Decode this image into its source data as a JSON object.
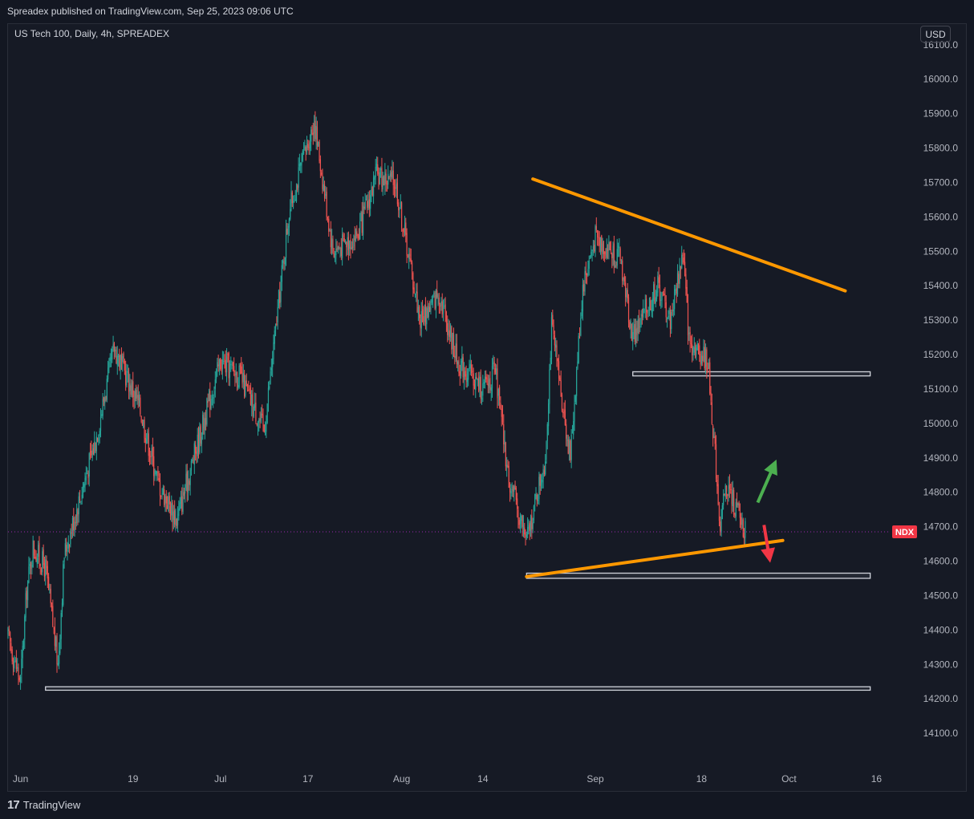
{
  "header": {
    "published": "Spreadex published on TradingView.com, Sep 25, 2023 09:06 UTC"
  },
  "legend": {
    "symbol_line": "US Tech 100, Daily, 4h, SPREADEX"
  },
  "price_scale": {
    "currency": "USD"
  },
  "footer": {
    "brand": "TradingView"
  },
  "colors": {
    "background": "#161a25",
    "up": "#26a69a",
    "down": "#ef5350",
    "trendline": "#ff9800",
    "arrow_up": "#4caf50",
    "arrow_down": "#f23645",
    "current_price_line": "#9c27b0",
    "ndx_label": "#f23645",
    "zone_border": "#d1d4dc"
  },
  "chart_data": {
    "type": "candlestick",
    "title": "US Tech 100, Daily, 4h, SPREADEX",
    "y_axis": {
      "ticks": [
        14100,
        14200,
        14300,
        14400,
        14500,
        14600,
        14700,
        14800,
        14900,
        15000,
        15100,
        15200,
        15300,
        15400,
        15500,
        15600,
        15700,
        15800,
        15900,
        16000,
        16100
      ],
      "ylim": [
        14000,
        16160
      ],
      "label_format": "one_decimal"
    },
    "x_axis": {
      "ticks": [
        {
          "label": "Jun",
          "date": "2023-06-01"
        },
        {
          "label": "19",
          "date": "2023-06-19"
        },
        {
          "label": "Jul",
          "date": "2023-07-03"
        },
        {
          "label": "17",
          "date": "2023-07-17"
        },
        {
          "label": "Aug",
          "date": "2023-08-01"
        },
        {
          "label": "14",
          "date": "2023-08-14"
        },
        {
          "label": "Sep",
          "date": "2023-09-01"
        },
        {
          "label": "18",
          "date": "2023-09-18"
        },
        {
          "label": "Oct",
          "date": "2023-10-02"
        },
        {
          "label": "16",
          "date": "2023-10-16"
        }
      ],
      "range": [
        "2023-05-30",
        "2023-10-18"
      ]
    },
    "current_price": {
      "label": "NDX",
      "value": 14685
    },
    "price_path": [
      [
        "2023-05-30",
        14380
      ],
      [
        "2023-06-01",
        14250
      ],
      [
        "2023-06-02",
        14520
      ],
      [
        "2023-06-03",
        14640
      ],
      [
        "2023-06-05",
        14580
      ],
      [
        "2023-06-07",
        14300
      ],
      [
        "2023-06-08",
        14620
      ],
      [
        "2023-06-13",
        14950
      ],
      [
        "2023-06-16",
        15220
      ],
      [
        "2023-06-20",
        15050
      ],
      [
        "2023-06-23",
        14830
      ],
      [
        "2023-06-26",
        14720
      ],
      [
        "2023-06-29",
        14920
      ],
      [
        "2023-07-03",
        15180
      ],
      [
        "2023-07-06",
        15140
      ],
      [
        "2023-07-10",
        14980
      ],
      [
        "2023-07-14",
        15620
      ],
      [
        "2023-07-18",
        15880
      ],
      [
        "2023-07-21",
        15500
      ],
      [
        "2023-07-25",
        15550
      ],
      [
        "2023-07-28",
        15720
      ],
      [
        "2023-07-31",
        15700
      ],
      [
        "2023-08-04",
        15300
      ],
      [
        "2023-08-07",
        15380
      ],
      [
        "2023-08-10",
        15180
      ],
      [
        "2023-08-14",
        15100
      ],
      [
        "2023-08-16",
        15150
      ],
      [
        "2023-08-18",
        14850
      ],
      [
        "2023-08-21",
        14660
      ],
      [
        "2023-08-24",
        14900
      ],
      [
        "2023-08-25",
        15280
      ],
      [
        "2023-08-28",
        14900
      ],
      [
        "2023-08-30",
        15400
      ],
      [
        "2023-09-01",
        15540
      ],
      [
        "2023-09-05",
        15480
      ],
      [
        "2023-09-07",
        15250
      ],
      [
        "2023-09-11",
        15400
      ],
      [
        "2023-09-13",
        15300
      ],
      [
        "2023-09-15",
        15500
      ],
      [
        "2023-09-16",
        15240
      ],
      [
        "2023-09-19",
        15180
      ],
      [
        "2023-09-20",
        14950
      ],
      [
        "2023-09-21",
        14700
      ],
      [
        "2023-09-22",
        14820
      ],
      [
        "2023-09-25",
        14685
      ]
    ],
    "annotations": {
      "trendlines": [
        {
          "name": "resistance",
          "start": [
            "2023-08-22",
            15710
          ],
          "end": [
            "2023-10-11",
            15385
          ]
        },
        {
          "name": "support",
          "start": [
            "2023-08-21",
            14555
          ],
          "end": [
            "2023-10-01",
            14660
          ]
        }
      ],
      "zones": [
        {
          "name": "zone-15150",
          "start": "2023-09-07",
          "end": "2023-10-15",
          "low": 15138,
          "high": 15150
        },
        {
          "name": "zone-14560",
          "start": "2023-08-21",
          "end": "2023-10-15",
          "low": 14550,
          "high": 14565
        },
        {
          "name": "zone-14230",
          "start": "2023-06-05",
          "end": "2023-10-15",
          "low": 14225,
          "high": 14235
        }
      ],
      "arrows": [
        {
          "name": "bullish-arrow",
          "direction": "up",
          "from": [
            "2023-09-27",
            14770
          ],
          "to": [
            "2023-09-30",
            14895
          ]
        },
        {
          "name": "bearish-arrow",
          "direction": "down",
          "from": [
            "2023-09-28",
            14705
          ],
          "to": [
            "2023-09-29",
            14595
          ]
        }
      ]
    }
  }
}
